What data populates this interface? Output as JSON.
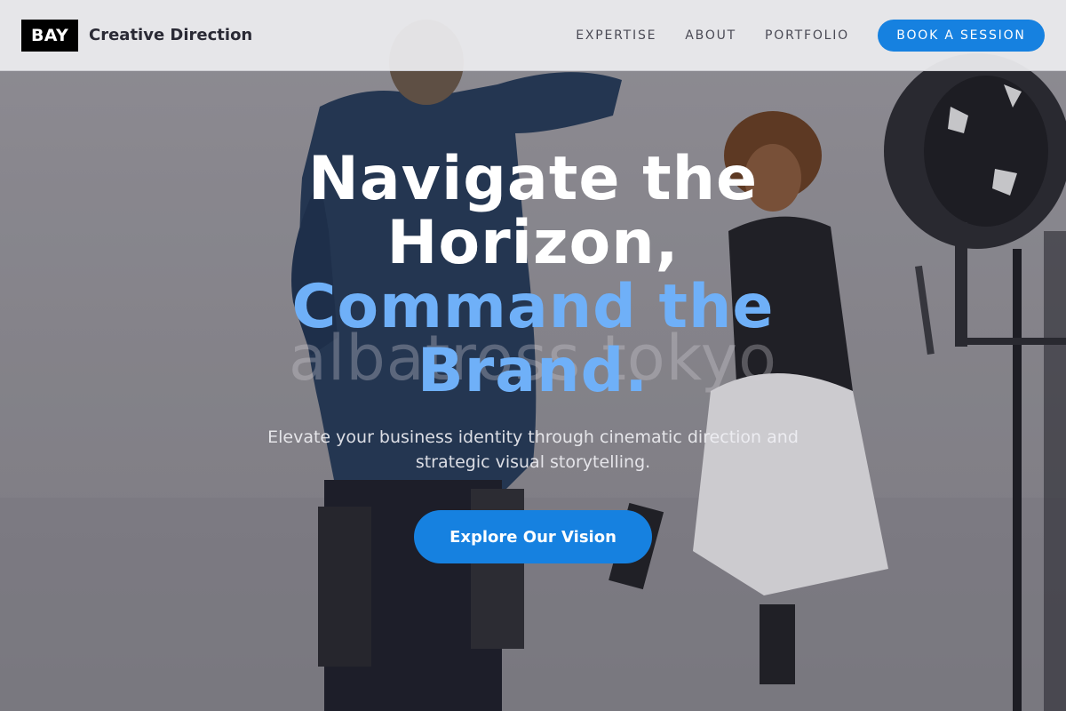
{
  "header": {
    "logo_text": "BAY",
    "brand_name": "Creative Direction",
    "nav": [
      {
        "label": "EXPERTISE"
      },
      {
        "label": "ABOUT"
      },
      {
        "label": "PORTFOLIO"
      }
    ],
    "cta_label": "BOOK A SESSION"
  },
  "hero": {
    "title_line1": "Navigate the",
    "title_line2": "Horizon,",
    "title_accent_line1": "Command the",
    "title_accent_line2": "Brand.",
    "watermark": "albatross tokyo",
    "subtitle": "Elevate your business identity through cinematic direction and strategic visual storytelling.",
    "cta_label": "Explore Our Vision"
  },
  "colors": {
    "accent": "#1681e0",
    "title_accent": "#6fb0f8",
    "header_bg": "#ececee",
    "logo_bg": "#000000"
  }
}
